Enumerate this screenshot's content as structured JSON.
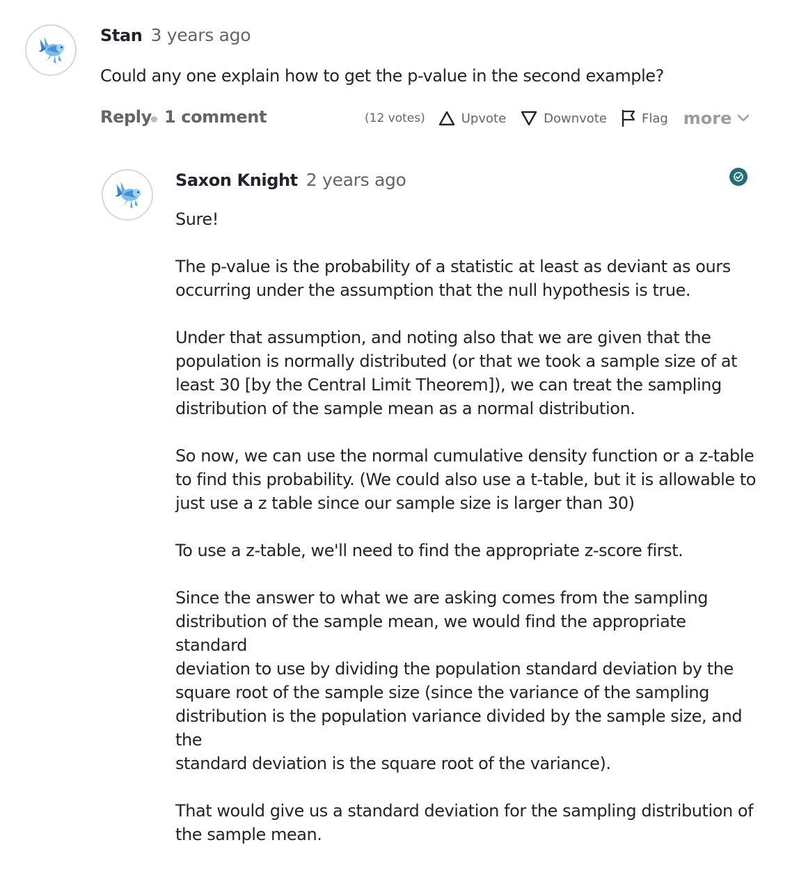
{
  "question": {
    "author": "Stan",
    "timestamp": "3 years ago",
    "text": "Could any one explain how to get the p-value in the second example?",
    "actions": {
      "reply": "Reply",
      "comments": "1 comment",
      "votes": "(12 votes)",
      "upvote": "Upvote",
      "downvote": "Downvote",
      "flag": "Flag",
      "more": "more"
    }
  },
  "answer": {
    "author": "Saxon Knight",
    "timestamp": "2 years ago",
    "paragraphs": [
      "Sure!",
      "The p-value is the probability of a statistic at least as deviant as ours\noccurring under the assumption that the null hypothesis is true.",
      "Under that assumption, and noting also that we are given that the\npopulation is normally distributed (or that we took a sample size of at\nleast 30 [by the Central Limit Theorem]), we can treat the sampling\ndistribution of the sample mean as a normal distribution.",
      "So now, we can use the normal cumulative density function or a z-table\nto find this probability. (We could also use a t-table, but it is allowable to\njust use a z table since our sample size is larger than 30)",
      "To use a z-table, we'll need to find the appropriate z-score first.",
      "Since the answer to what we are asking comes from the sampling\ndistribution of the sample mean, we would find the appropriate standard\ndeviation to use by dividing the population standard deviation by the\nsquare root of the sample size (since the variance of the sampling\ndistribution is the population variance divided by the sample size, and the\nstandard deviation is the square root of the variance).",
      "That would give us a standard deviation for the sampling distribution of\nthe sample mean."
    ]
  },
  "icons": {
    "avatar": "blue-creature-avatar-icon",
    "upvote": "triangle-up-outline-icon",
    "downvote": "triangle-down-outline-icon",
    "flag": "flag-outline-icon",
    "more": "chevron-down-icon",
    "badge": "approved-answer-check-icon"
  },
  "colors": {
    "text": "#21242c",
    "muted": "#626569",
    "more": "#9a9da1",
    "badge": "#1f6f74",
    "avatar_blue": "#5aa7e3"
  }
}
